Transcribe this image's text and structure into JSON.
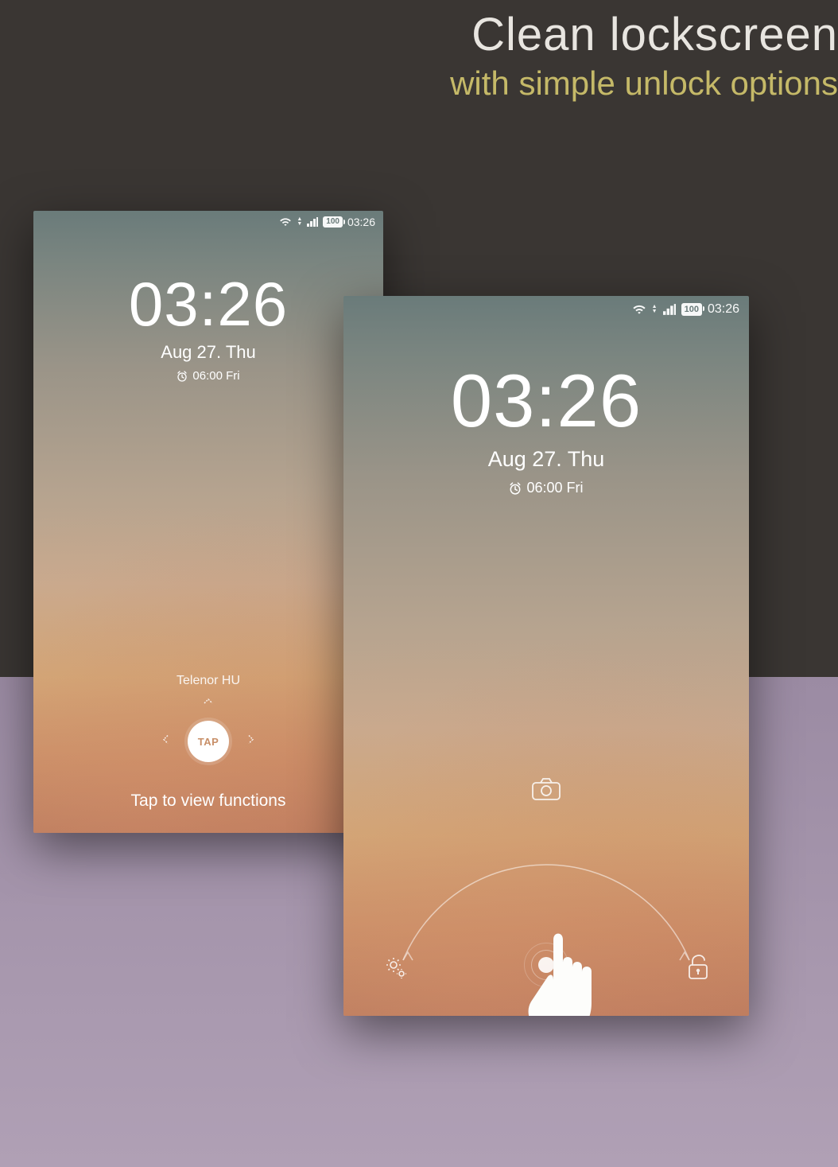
{
  "heading": {
    "title": "Clean lockscreen",
    "subtitle": "with simple unlock options"
  },
  "status": {
    "battery_level": "100",
    "time": "03:26"
  },
  "lockscreen": {
    "time": "03:26",
    "date": "Aug 27. Thu",
    "alarm": "06:00 Fri"
  },
  "left_panel": {
    "carrier": "Telenor HU",
    "tap_label": "TAP",
    "hint": "Tap to view functions"
  }
}
